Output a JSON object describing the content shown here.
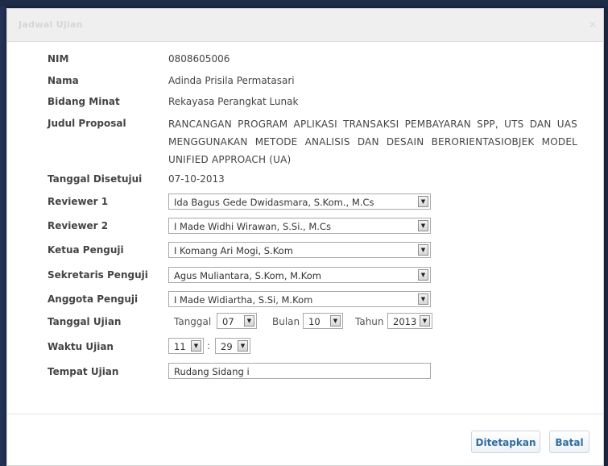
{
  "dialog": {
    "title": "Jadwal Ujian",
    "close_glyph": "×"
  },
  "fields": {
    "nim": {
      "label": "NIM",
      "value": "0808605006"
    },
    "nama": {
      "label": "Nama",
      "value": "Adinda Prisila Permatasari"
    },
    "bidang": {
      "label": "Bidang Minat",
      "value": "Rekayasa Perangkat Lunak"
    },
    "judul": {
      "label": "Judul Proposal",
      "value": "RANCANGAN PROGRAM APLIKASI TRANSAKSI PEMBAYARAN SPP, UTS DAN UAS MENGGUNAKAN METODE ANALISIS DAN DESAIN BERORIENTASIOBJEK MODEL UNIFIED APPROACH (UA)"
    },
    "tanggal_disetujui": {
      "label": "Tanggal Disetujui",
      "value": "07-10-2013"
    },
    "reviewer1": {
      "label": "Reviewer 1",
      "value": "Ida Bagus Gede Dwidasmara, S.Kom., M.Cs"
    },
    "reviewer2": {
      "label": "Reviewer 2",
      "value": "I Made Widhi Wirawan, S.Si., M.Cs"
    },
    "ketua": {
      "label": "Ketua Penguji",
      "value": "I Komang Ari Mogi, S.Kom"
    },
    "sekretaris": {
      "label": "Sekretaris Penguji",
      "value": "Agus Muliantara, S.Kom, M.Kom"
    },
    "anggota": {
      "label": "Anggota Penguji",
      "value": "I Made Widiartha, S.Si, M.Kom"
    },
    "tanggal_ujian": {
      "label": "Tanggal Ujian",
      "tanggal_label": "Tanggal",
      "tanggal_value": "07",
      "bulan_label": "Bulan",
      "bulan_value": "10",
      "tahun_label": "Tahun",
      "tahun_value": "2013"
    },
    "waktu_ujian": {
      "label": "Waktu Ujian",
      "hour": "11",
      "separator": ":",
      "minute": "29"
    },
    "tempat_ujian": {
      "label": "Tempat Ujian",
      "value": "Rudang Sidang i"
    }
  },
  "buttons": {
    "submit": "Ditetapkan",
    "cancel": "Batal"
  },
  "icons": {
    "dropdown": "▼"
  }
}
